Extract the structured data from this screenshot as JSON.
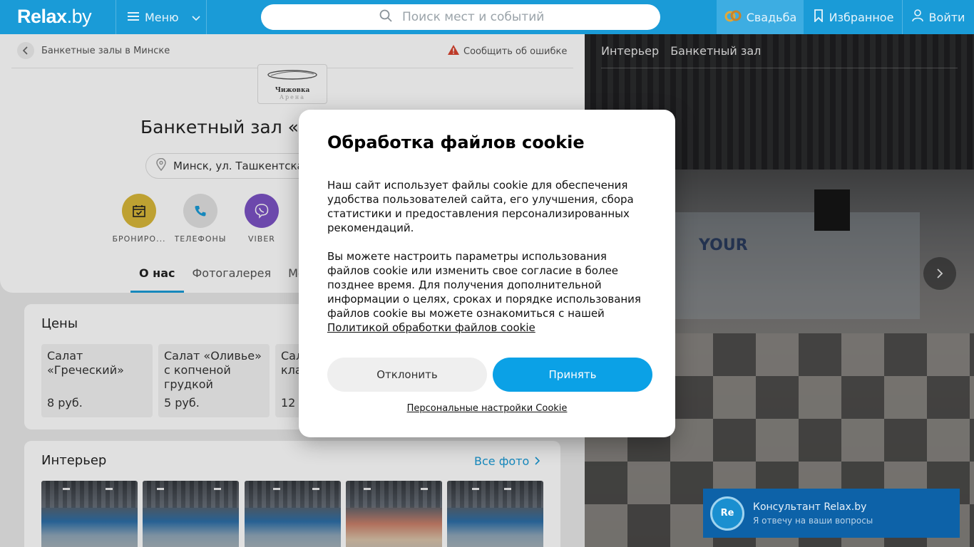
{
  "header": {
    "logo_main": "Relax",
    "logo_suffix": ".by",
    "menu_label": "Меню",
    "search_placeholder": "Поиск мест и событий",
    "wedding_label": "Свадьба",
    "favorites_label": "Избранное",
    "login_label": "Войти",
    "colors": {
      "bar": "#1a9bd7",
      "wedding_bg": "#3dade2"
    }
  },
  "page": {
    "breadcrumb": "Банкетные залы в Минске",
    "report_error": "Сообщить об ошибке",
    "logo_line1": "Чижовка",
    "logo_line2": "Арена",
    "title": "Банкетный зал «Ч",
    "address": "Минск, ул. Ташкентская",
    "actions": [
      {
        "label": "БРОНИРО...",
        "icon": "calendar-check-icon",
        "color": "#d9b83a"
      },
      {
        "label": "ТЕЛЕФОНЫ",
        "icon": "phone-icon",
        "color": "#e2e2e2"
      },
      {
        "label": "VIBER",
        "icon": "viber-icon",
        "color": "#7b53c4"
      }
    ],
    "tabs": [
      "О нас",
      "Фотогалерея",
      "Мен"
    ]
  },
  "prices": {
    "heading": "Цены",
    "items": [
      {
        "name": "Салат «Греческий»",
        "price": "8 руб."
      },
      {
        "name": "Салат «Оливье» с копченой грудкой",
        "price": "5 руб."
      },
      {
        "name": "Сал кла",
        "price": "12"
      }
    ]
  },
  "interior": {
    "heading": "Интерьер",
    "all_photos": "Все фото"
  },
  "photo_panel": {
    "tabs": [
      "Интерьер",
      "Банкетный зал"
    ],
    "wall_text": "YOUR"
  },
  "chat": {
    "avatar": "Re",
    "title": "Консультант Relax.by",
    "subtitle": "Я отвечу на ваши вопросы"
  },
  "cookie": {
    "title": "Обработка файлов cookie",
    "para1": "Наш сайт использует файлы cookie для обеспечения удобства пользователей сайта, его улучшения, сбора статистики и предоставления персонализированных рекомендаций.",
    "para2": "Вы можете настроить параметры использования файлов cookie или изменить свое согласие в более позднее время. Для получения дополнительной информации о целях, сроках и порядке использования файлов cookie вы можете ознакомиться с нашей",
    "policy_link": "Политикой обработки файлов cookie",
    "decline": "Отклонить",
    "accept": "Принять",
    "settings": "Персональные настройки Cookie",
    "accent_color": "#0ba1e6"
  }
}
